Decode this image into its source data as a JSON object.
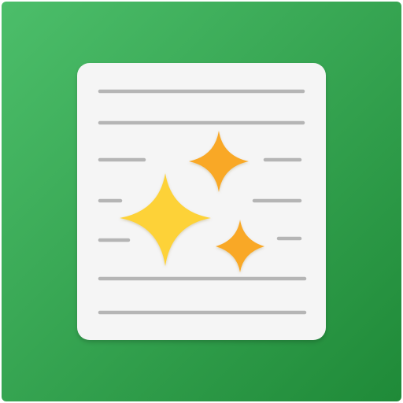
{
  "icon": {
    "name": "document-sparkle-app-icon",
    "background_gradient": [
      "#4cbe6a",
      "#1f8a38"
    ],
    "page_color": "#f5f5f5",
    "line_color": "#b5b5b5",
    "sparkle_large_color": "#fdd237",
    "sparkle_small_color": "#f9a825"
  }
}
